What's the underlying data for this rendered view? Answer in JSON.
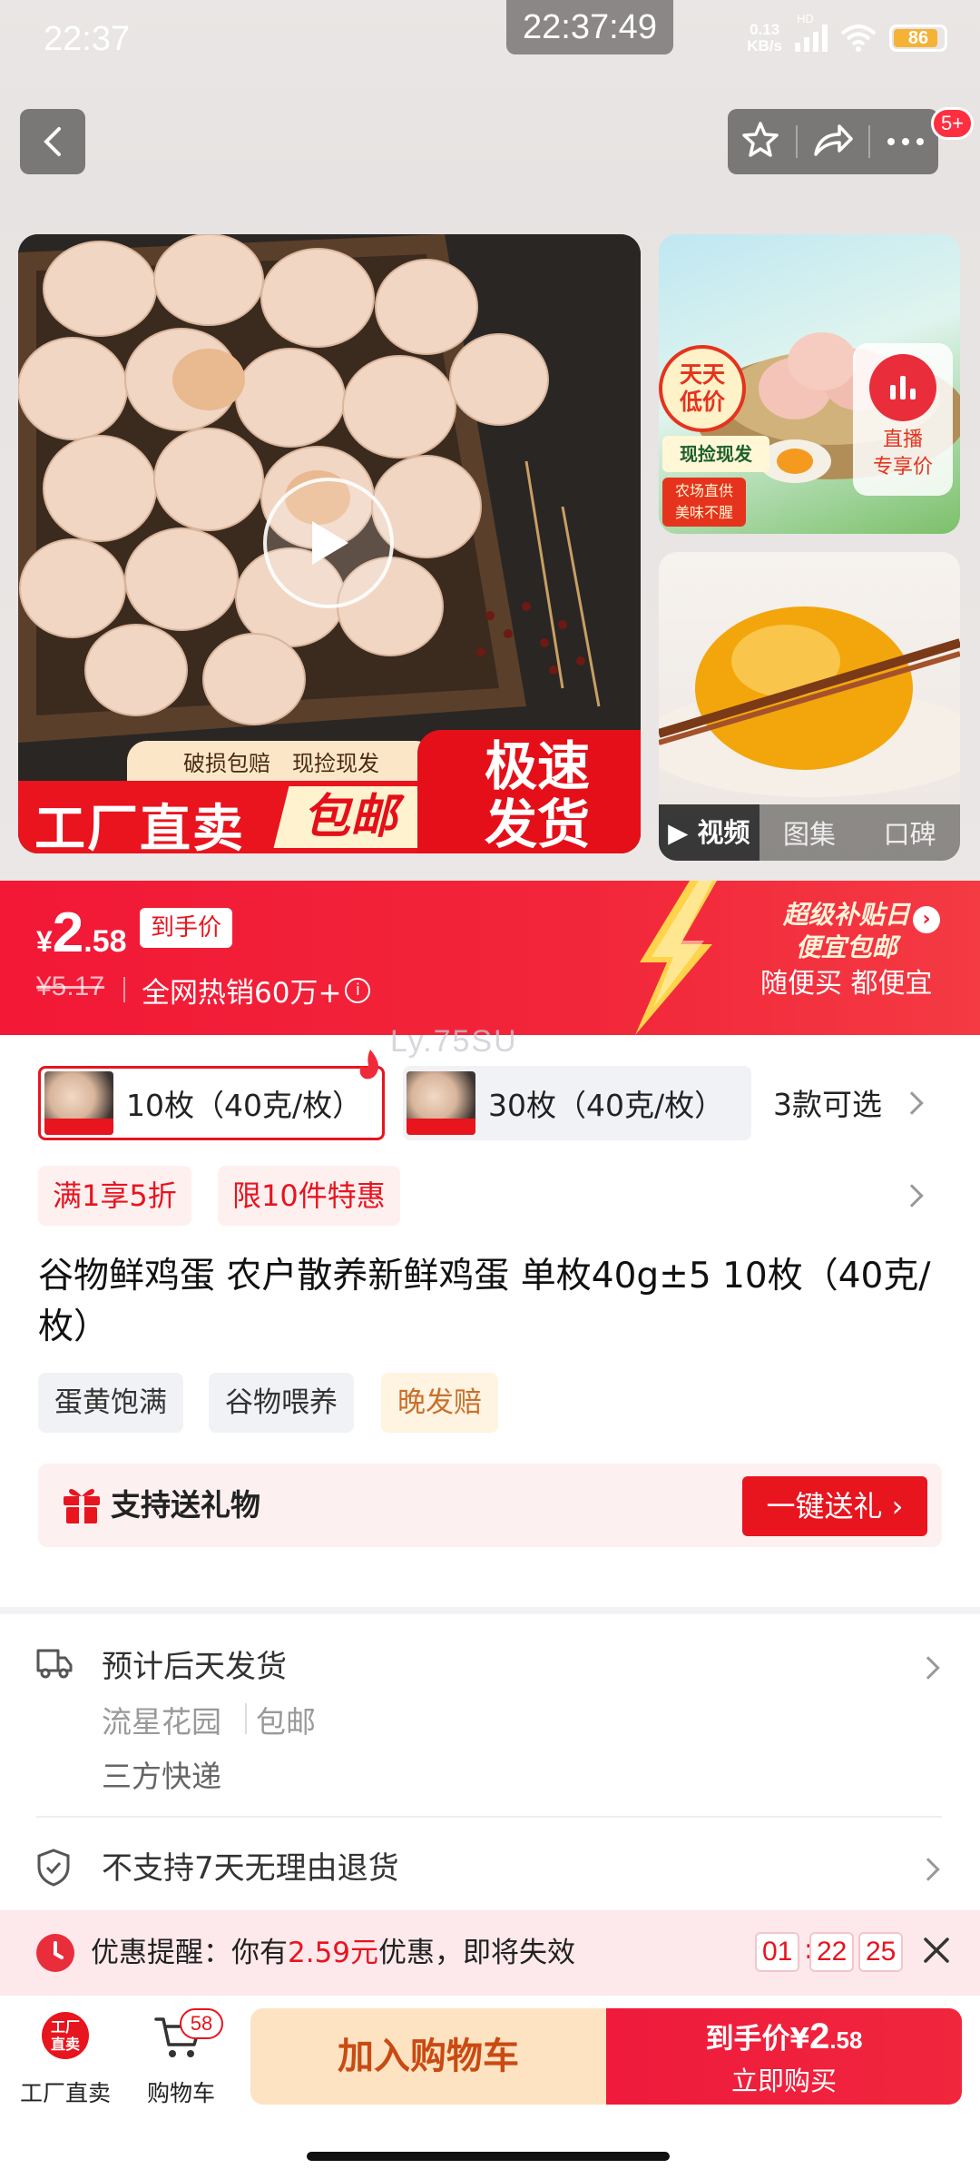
{
  "status_bar": {
    "time": "22:37",
    "clock_overlay": "22:37:49",
    "net_speed_value": "0.13",
    "net_speed_unit": "KB/s",
    "network_tag": "HD",
    "battery": "86"
  },
  "header": {
    "more_badge": "5+"
  },
  "gallery": {
    "banner_small": [
      "破损包赔",
      "现捡现发"
    ],
    "banner_left_1": "工厂直卖",
    "banner_left_2": "包邮",
    "banner_right": [
      "极速",
      "发货"
    ],
    "side_badge": [
      "天天",
      "低价"
    ],
    "side_tag": "现捡现发",
    "side_tag2": [
      "农场直供",
      "美味不腥"
    ],
    "live_label": [
      "直播",
      "专享价"
    ],
    "media_tabs": [
      "视频",
      "图集",
      "口碑"
    ]
  },
  "price": {
    "currency": "¥",
    "integer": "2",
    "decimal": ".58",
    "tag": "到手价",
    "original": "¥5.17",
    "hot": "全网热销60万+",
    "subsidy_title_1": "超级补贴日",
    "subsidy_title_2": "便宜包邮",
    "subsidy_sub": "随便买 都便宜"
  },
  "watermark": "Ly.75SU",
  "skus": {
    "selected": "10枚（40克/枚）",
    "other": "30枚（40克/枚）",
    "more": "3款可选"
  },
  "promos": [
    "满1享5折",
    "限10件特惠"
  ],
  "product_title": "谷物鲜鸡蛋 农户散养新鲜鸡蛋 单枚40g±5 10枚（40克/枚）",
  "tags": [
    "蛋黄饱满",
    "谷物喂养",
    "晚发赔"
  ],
  "gift": {
    "label": "支持送礼物",
    "button": "一键送礼 ›"
  },
  "shipping": {
    "estimate": "预计后天发货",
    "origin": "流星花园",
    "free_shipping": "包邮",
    "courier": "三方快递",
    "return_policy": "不支持7天无理由退货"
  },
  "reminder": {
    "prefix": "优惠提醒：你有",
    "amount": "2.59元",
    "suffix": "优惠，即将失效",
    "hours": "01",
    "minutes": "22",
    "seconds": "25"
  },
  "bottom": {
    "factory_logo": [
      "工厂",
      "直卖"
    ],
    "factory_label": "工厂直卖",
    "cart_label": "购物车",
    "cart_badge": "58",
    "add_cart": "加入购物车",
    "buy_prefix": "到手价¥",
    "buy_price_int": "2",
    "buy_price_dec": ".58",
    "buy_now": "立即购买"
  },
  "colors": {
    "accent_red": "#e8141e",
    "price_banner": "#f21836",
    "add_cart_bg": "#fde3c1",
    "tag_orange": "#c9702b"
  }
}
